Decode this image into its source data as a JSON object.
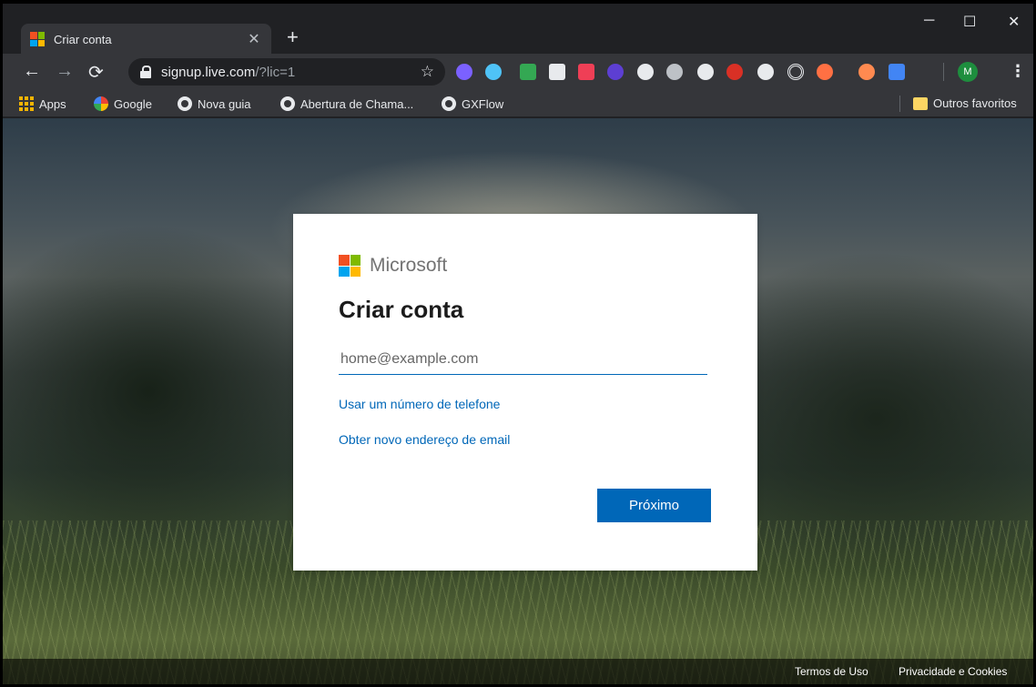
{
  "tab": {
    "title": "Criar conta"
  },
  "address": {
    "host": "signup.live.com",
    "path": "/?lic=1"
  },
  "profile": {
    "initial": "M"
  },
  "bookmarks": {
    "apps": "Apps",
    "google": "Google",
    "nova_guia": "Nova guia",
    "abertura": "Abertura de Chama...",
    "gxflow": "GXFlow",
    "outros": "Outros favoritos"
  },
  "signup": {
    "brand": "Microsoft",
    "heading": "Criar conta",
    "email_placeholder": "home@example.com",
    "phone_link": "Usar um número de telefone",
    "new_email_link": "Obter novo endereço de email",
    "next_button": "Próximo"
  },
  "footer": {
    "terms": "Termos de Uso",
    "privacy": "Privacidade e Cookies"
  },
  "colors": {
    "ms_red": "#f25022",
    "ms_green": "#7fba00",
    "ms_blue": "#00a4ef",
    "ms_yellow": "#ffb900",
    "accent": "#0067b8"
  },
  "extension_icons": [
    "puzzle-icon",
    "dots-icon",
    "maps-icon",
    "drive-icon",
    "pocket-icon",
    "acrobat-icon",
    "circle-icon",
    "gear-icon",
    "record-icon",
    "abp-icon",
    "eye-icon",
    "target-icon",
    "pen-icon",
    "block-icon",
    "shield-icon"
  ]
}
